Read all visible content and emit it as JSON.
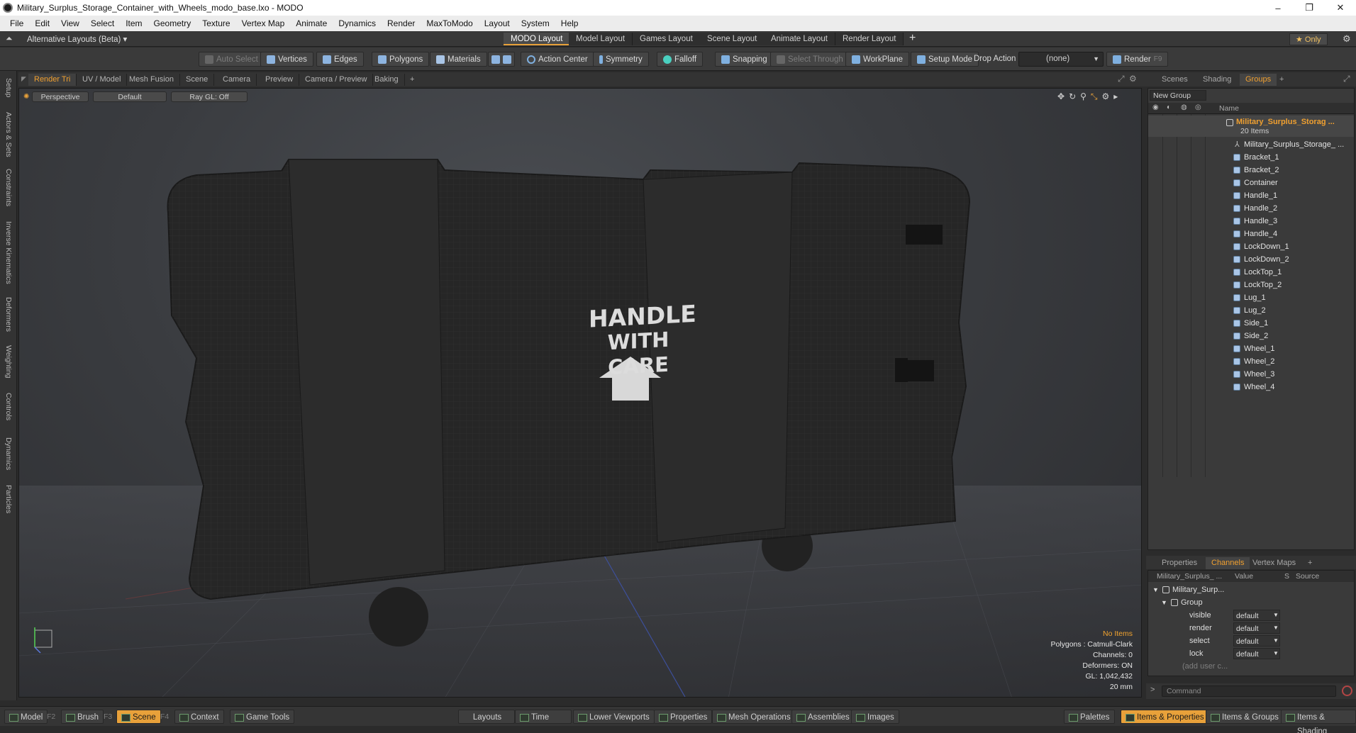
{
  "window": {
    "title": "Military_Surplus_Storage_Container_with_Wheels_modo_base.lxo - MODO",
    "controls": [
      "–",
      "❐",
      "✕"
    ]
  },
  "menu": [
    "File",
    "Edit",
    "View",
    "Select",
    "Item",
    "Geometry",
    "Texture",
    "Vertex Map",
    "Animate",
    "Dynamics",
    "Render",
    "MaxToModo",
    "Layout",
    "System",
    "Help"
  ],
  "layoutbar": {
    "alt_layouts": "Alternative Layouts (Beta) ▾",
    "tabs": [
      "MODO Layout",
      "Model Layout",
      "Games Layout",
      "Scene Layout",
      "Animate Layout",
      "Render Layout"
    ],
    "active_tab": "MODO Layout",
    "add": "+",
    "only_label": "★  Only"
  },
  "toolbar": {
    "auto_select": "Auto Select",
    "vertices": "Vertices",
    "edges": "Edges",
    "polygons": "Polygons",
    "materials": "Materials",
    "action_center": "Action Center",
    "symmetry": "Symmetry",
    "falloff": "Falloff",
    "snapping": "Snapping",
    "select_through": "Select Through",
    "workplane": "WorkPlane",
    "setup_mode": "Setup Mode",
    "drop_action": "Drop Action",
    "drop_value": "(none)",
    "render": "Render",
    "render_key": "F9"
  },
  "left_tabs": [
    "Setup",
    "Actors & Sets",
    "Constraints",
    "Inverse Kinematics",
    "Deformers",
    "Weighting",
    "Controls",
    "Dynamics",
    "Particles"
  ],
  "viewport_tabs": [
    "Render Tri",
    "UV / Model",
    "Mesh Fusion",
    "Scene",
    "Camera",
    "Preview",
    "Camera / Preview",
    "Baking",
    "+"
  ],
  "viewport": {
    "view": "Perspective",
    "shading": "Default",
    "raygl": "Ray GL: Off",
    "decal_line1": "HANDLE",
    "decal_line2": "WITH CARE",
    "hud": {
      "items": "No Items",
      "polygons": "Polygons : Catmull-Clark",
      "channels": "Channels: 0",
      "deformers": "Deformers: ON",
      "gl": "GL: 1,042,432",
      "unit": "20 mm"
    }
  },
  "groups_panel": {
    "tabs": [
      "Scenes",
      "Shading",
      "Groups",
      "+"
    ],
    "active_tab": "Groups",
    "new_group": "New Group",
    "name_header": "Name",
    "root_name": "Military_Surplus_Storag ...",
    "root_count": "20 Items",
    "items": [
      "Military_Surplus_Storage_ ...",
      "Bracket_1",
      "Bracket_2",
      "Container",
      "Handle_1",
      "Handle_2",
      "Handle_3",
      "Handle_4",
      "LockDown_1",
      "LockDown_2",
      "LockTop_1",
      "LockTop_2",
      "Lug_1",
      "Lug_2",
      "Side_1",
      "Side_2",
      "Wheel_1",
      "Wheel_2",
      "Wheel_3",
      "Wheel_4"
    ]
  },
  "channels_panel": {
    "tabs": [
      "Properties",
      "Channels",
      "Vertex Maps",
      "+"
    ],
    "active_tab": "Channels",
    "headers": {
      "name": "Military_Surplus_ ...",
      "value": "Value",
      "s": "S",
      "source": "Source"
    },
    "item": "Military_Surp...",
    "group": "Group",
    "rows": [
      {
        "name": "visible",
        "value": "default"
      },
      {
        "name": "render",
        "value": "default"
      },
      {
        "name": "select",
        "value": "default"
      },
      {
        "name": "lock",
        "value": "default"
      }
    ],
    "add_user": "(add user c..."
  },
  "command": {
    "placeholder": "Command"
  },
  "bottombar": {
    "model": "Model",
    "model_key": "F2",
    "brush": "Brush",
    "brush_key": "F3",
    "scene": "Scene",
    "scene_key": "F4",
    "context": "Context",
    "game_tools": "Game Tools",
    "layouts": "Layouts",
    "time": "Time",
    "lower_viewports": "Lower Viewports",
    "properties": "Properties",
    "mesh_operations": "Mesh Operations",
    "assemblies": "Assemblies",
    "images": "Images",
    "palettes": "Palettes",
    "items_properties": "Items & Properties",
    "items_groups": "Items & Groups",
    "items_shading": "Items & Shading"
  },
  "colors": {
    "accent": "#e8a13a",
    "highlight": "#f0a030"
  }
}
